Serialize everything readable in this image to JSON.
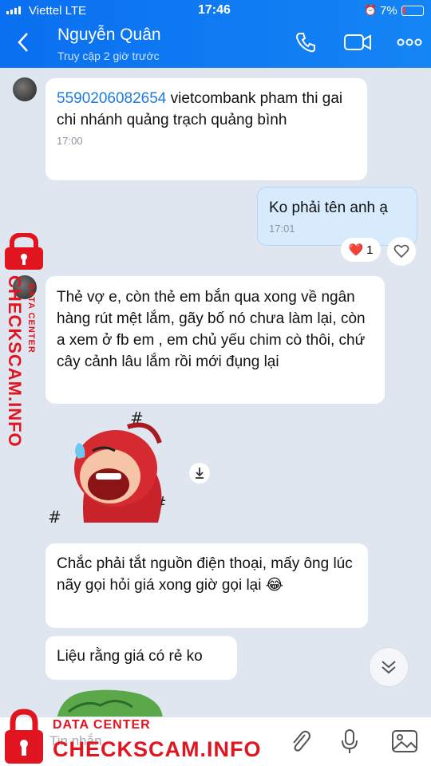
{
  "status_bar": {
    "carrier": "Viettel  LTE",
    "time": "17:46",
    "battery": "7%"
  },
  "header": {
    "contact_name": "Nguyễn Quân",
    "contact_status": "Truy cập 2 giờ trước",
    "icons": [
      "back-icon",
      "phone-icon",
      "video-icon",
      "more-icon"
    ]
  },
  "messages": [
    {
      "account": "5590206082654",
      "text": " vietcombank pham thi gai chi nhánh quảng trạch quảng bình",
      "time": "17:00"
    },
    {
      "text": "Ko phải tên anh ạ",
      "time": "17:01"
    },
    {
      "text": "Thẻ vợ e, còn thẻ em bắn qua xong về ngân hàng rút mệt lắm, gãy bố nó chưa làm lại, còn a xem ở fb em , em chủ yếu chim cò thôi, chứ cây cảnh lâu lắm rồi mới đụng lại"
    },
    {
      "text": "Chắc phải tắt nguồn điện thoại, mấy ông lúc nãy gọi hỏi giá xong giờ gọi lại",
      "emoji": "😂"
    },
    {
      "text": "Liệu rằng giá có rẻ ko"
    }
  ],
  "reaction": {
    "emoji": "❤️",
    "count": "1"
  },
  "input": {
    "placeholder": "Tin nhắn"
  },
  "watermark": {
    "small": "DATA CENTER",
    "big": "CHECKSCAM.INFO"
  },
  "colors": {
    "header": "#0a6ff0",
    "watermark": "#e0151f",
    "out_bubble": "#d7ebfd"
  }
}
